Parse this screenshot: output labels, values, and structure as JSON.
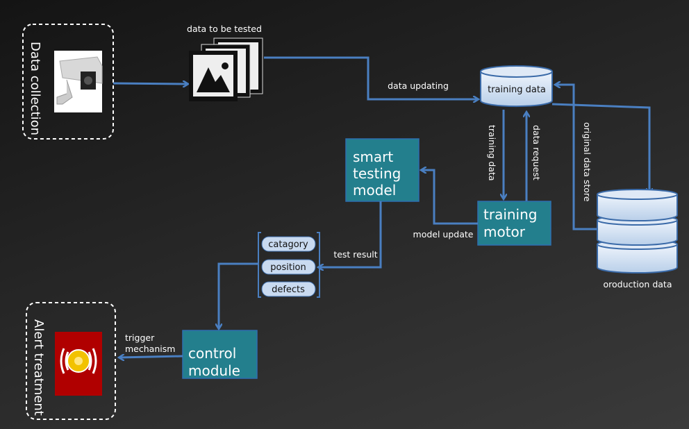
{
  "colors": {
    "arrow": "#4a7fc1",
    "module": "#237f8d",
    "cylinder": "#c9daf0",
    "alarm_bg": "#b00000",
    "alarm_light": "#f2c200"
  },
  "sections": {
    "data_collection": "Data collection",
    "alert_treatment": "Alert treatment"
  },
  "labels": {
    "data_to_be_tested": "data to be tested",
    "data_updating": "data updating",
    "training_data_arrow": "training data",
    "data_request": "data request",
    "original_data_store": "original data store",
    "model_update": "model update",
    "test_result": "test result",
    "trigger_line1": "trigger",
    "trigger_line2": "mechanism",
    "production_data": "oroduction data"
  },
  "nodes": {
    "training_data": "training data",
    "smart_testing_model": [
      "smart",
      "testing",
      "model"
    ],
    "training_motor": [
      "training",
      "motor"
    ],
    "control_module": [
      "control",
      "module"
    ]
  },
  "results": [
    "catagory",
    "position",
    "defects"
  ],
  "icons": {
    "camera": "security-camera-icon",
    "images": "image-stack-icon",
    "database": "database-icon",
    "alarm": "alarm-light-icon"
  }
}
